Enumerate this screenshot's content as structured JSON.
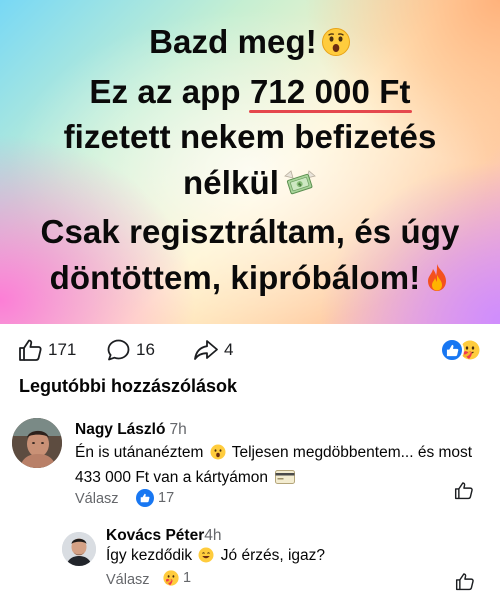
{
  "post": {
    "lines": [
      "Bazd meg!",
      "Ez az app",
      "712 000 Ft",
      "fizetett nekem befizetés",
      "nélkül",
      "Csak regisztráltam, és úgy",
      "döntöttem, kipróbálom!"
    ],
    "emojis": [
      "astonished-face",
      "money-with-wings",
      "fire"
    ],
    "accent_color": "#e5484d"
  },
  "stats": {
    "likes": "171",
    "comments": "16",
    "shares": "4"
  },
  "comments_section": {
    "title": "Legutóbbi hozzászólások"
  },
  "comments": [
    {
      "name": "Nagy László",
      "time": "7h",
      "text_a": "Én is utánanéztem",
      "text_b": "Teljesen megdöbbentem... és most 433 000 Ft van a kártyámon",
      "reply_label": "Válasz",
      "reaction_count": "17"
    },
    {
      "name": "Kovács Péter",
      "time": "4h",
      "text_a": "Így kezdődik",
      "text_b": "Jó érzés, igaz?",
      "reply_label": "Válasz",
      "reaction_count": "1"
    }
  ],
  "colors": {
    "facebook_blue": "#1877f2",
    "secondary_text": "#65676b"
  }
}
